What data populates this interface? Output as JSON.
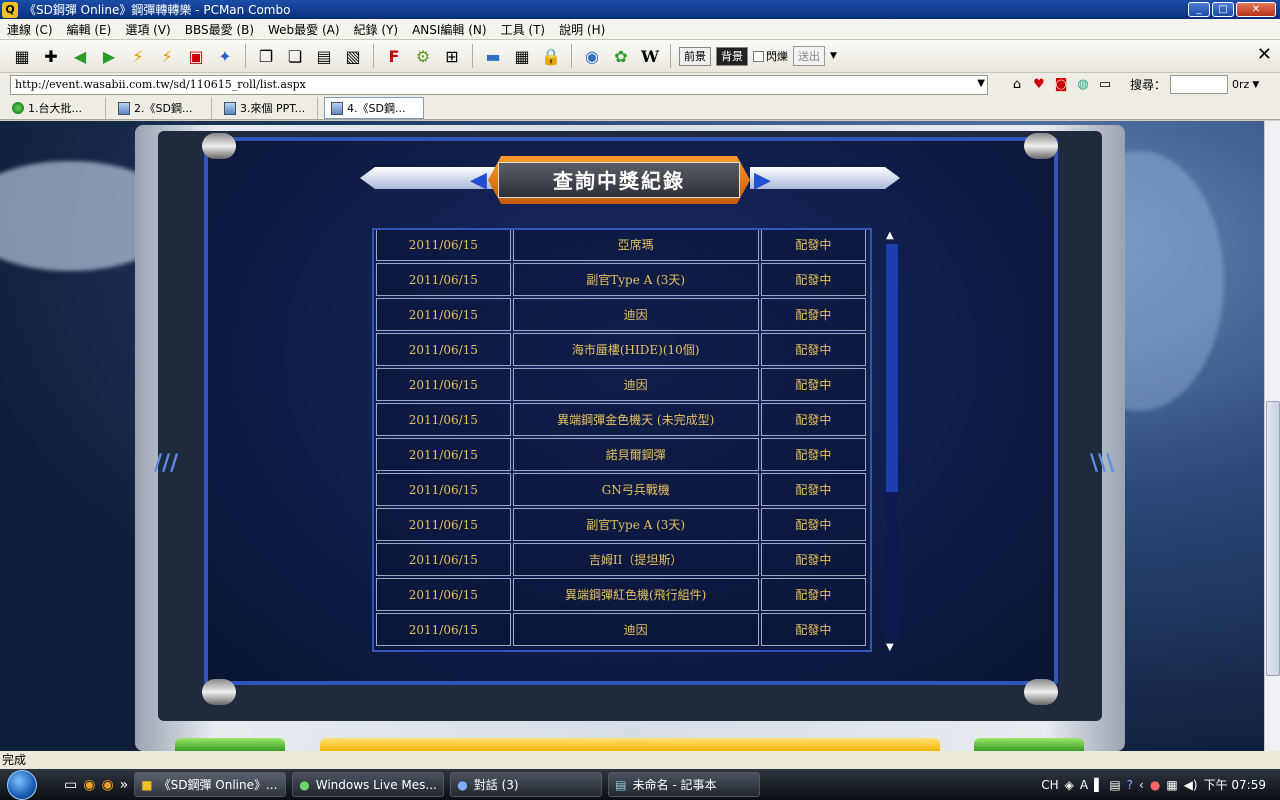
{
  "window": {
    "title": "《SD鋼彈 Online》鋼彈轉轉樂 - PCMan Combo",
    "app_icon": "Q"
  },
  "menu": [
    "連線 (C)",
    "編輯 (E)",
    "選項 (V)",
    "BBS最愛 (B)",
    "Web最愛 (A)",
    "紀錄 (Y)",
    "ANSI編輯 (N)",
    "工具 (T)",
    "說明 (H)"
  ],
  "toolbar": {
    "fg_label": "前景",
    "bg_label": "背景",
    "blink_label": "閃爍",
    "send_label": "送出"
  },
  "address": {
    "url": "http://event.wasabii.com.tw/sd/110615_roll/list.aspx",
    "search_label": "搜尋：",
    "search_engine": "0rz"
  },
  "tabs": [
    {
      "label": "1.台大批..."
    },
    {
      "label": "2.《SD鋼..."
    },
    {
      "label": "3.來個 PPT..."
    },
    {
      "label": "4.《SD鋼..."
    }
  ],
  "page": {
    "banner_title": "查詢中獎紀錄",
    "records": [
      {
        "date": "2011/06/15",
        "item": "亞席瑪",
        "status": "配發中"
      },
      {
        "date": "2011/06/15",
        "item": "副官Type A (3天)",
        "status": "配發中"
      },
      {
        "date": "2011/06/15",
        "item": "迪因",
        "status": "配發中"
      },
      {
        "date": "2011/06/15",
        "item": "海市蜃樓(HIDE)(10個)",
        "status": "配發中"
      },
      {
        "date": "2011/06/15",
        "item": "迪因",
        "status": "配發中"
      },
      {
        "date": "2011/06/15",
        "item": "異端鋼彈金色機天 (未完成型)",
        "status": "配發中"
      },
      {
        "date": "2011/06/15",
        "item": "諾貝爾鋼彈",
        "status": "配發中"
      },
      {
        "date": "2011/06/15",
        "item": "GN弓兵戰機",
        "status": "配發中"
      },
      {
        "date": "2011/06/15",
        "item": "副官Type A (3天)",
        "status": "配發中"
      },
      {
        "date": "2011/06/15",
        "item": "吉姆II（提坦斯）",
        "status": "配發中"
      },
      {
        "date": "2011/06/15",
        "item": "異端鋼彈紅色機(飛行組件)",
        "status": "配發中"
      },
      {
        "date": "2011/06/15",
        "item": "迪因",
        "status": "配發中"
      }
    ]
  },
  "status_bar": {
    "text": "完成"
  },
  "taskbar": {
    "tasks": [
      {
        "label": "《SD鋼彈 Online》..."
      },
      {
        "label": "Windows Live Mes..."
      },
      {
        "label": "對話 (3)"
      },
      {
        "label": "未命名 - 記事本"
      }
    ],
    "input_lang": "CH",
    "clock": "下午 07:59"
  },
  "colors": {
    "record_text": "#e5c05c",
    "panel_bg": "#0f1c47",
    "panel_border": "#2f56b8",
    "banner_plate": "#ff9a2a"
  }
}
